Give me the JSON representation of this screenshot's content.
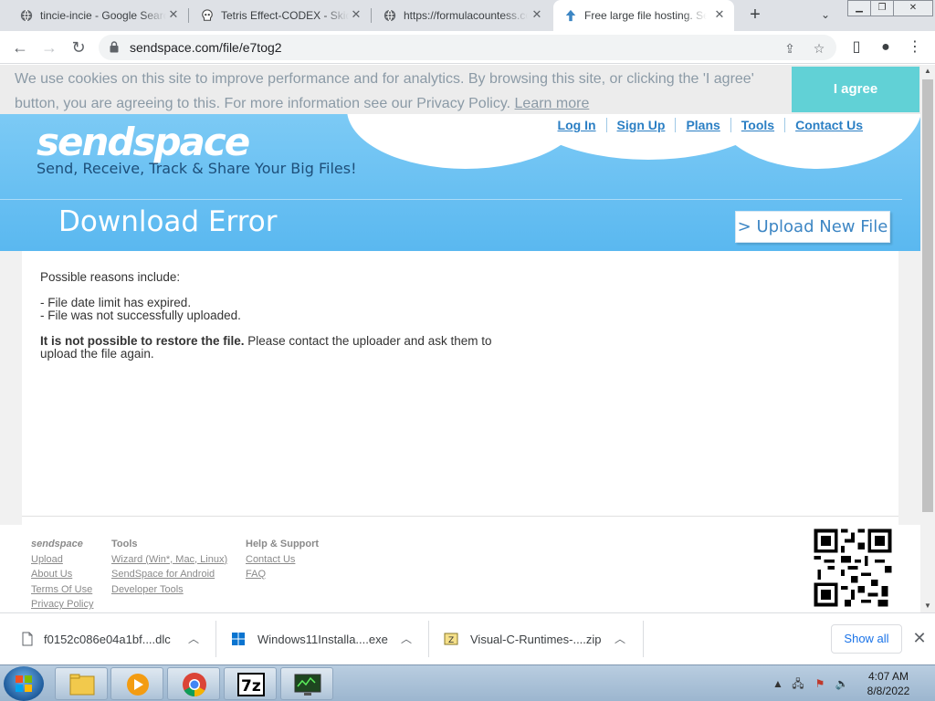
{
  "tabs": [
    {
      "title": "tincie-incie - Google Search",
      "icon": "globe-icon",
      "active": false
    },
    {
      "title": "Tetris Effect-CODEX - Skidrow",
      "icon": "skull-icon",
      "active": false
    },
    {
      "title": "https://formulacountess.com",
      "icon": "globe-icon",
      "active": false
    },
    {
      "title": "Free large file hosting. Send",
      "icon": "sendspace-icon",
      "active": true
    }
  ],
  "newtab_label": "+",
  "address": {
    "url": "sendspace.com/file/e7tog2"
  },
  "cookie": {
    "text": "We use cookies on this site to improve performance and for analytics. By browsing this site, or clicking the 'I agree' button, you are agreeing to this. For more information see our Privacy Policy. ",
    "link": "Learn more",
    "agree_label": "I agree"
  },
  "site": {
    "logo": "sendspace",
    "tagline": "Send, Receive, Track & Share Your Big Files!",
    "nav": [
      "Log In",
      "Sign Up",
      "Plans",
      "Tools",
      "Contact Us"
    ],
    "heading": "Download Error",
    "upload_button": "> Upload New File"
  },
  "error": {
    "reasons_intro": "Possible reasons include:",
    "reason_1": "- File date limit has expired.",
    "reason_2": "- File was not successfully uploaded.",
    "restore_bold": "It is not possible to restore the file.",
    "restore_rest": " Please contact the uploader and ask them to",
    "restore_rest_2": "upload the file again."
  },
  "footer": {
    "col1": {
      "head": "sendspace",
      "links": [
        "Upload",
        "About Us",
        "Terms Of Use",
        "Privacy Policy"
      ]
    },
    "col2": {
      "head": "Tools",
      "links": [
        "Wizard (Win*, Mac, Linux)",
        "SendSpace for Android",
        "Developer Tools"
      ]
    },
    "col3": {
      "head": "Help & Support",
      "links": [
        "Contact Us",
        "FAQ"
      ]
    }
  },
  "downloads": [
    {
      "name": "f0152c086e04a1bf....dlc",
      "icon": "file-icon"
    },
    {
      "name": "Windows11Installa....exe",
      "icon": "windows-icon"
    },
    {
      "name": "Visual-C-Runtimes-....zip",
      "icon": "zip-icon"
    }
  ],
  "show_all": "Show all",
  "taskbar": {
    "time": "4:07 AM",
    "date": "8/8/2022"
  },
  "colors": {
    "accent": "#61d1d6",
    "hero": "#5ab8f0",
    "link": "#2b7fc4"
  }
}
